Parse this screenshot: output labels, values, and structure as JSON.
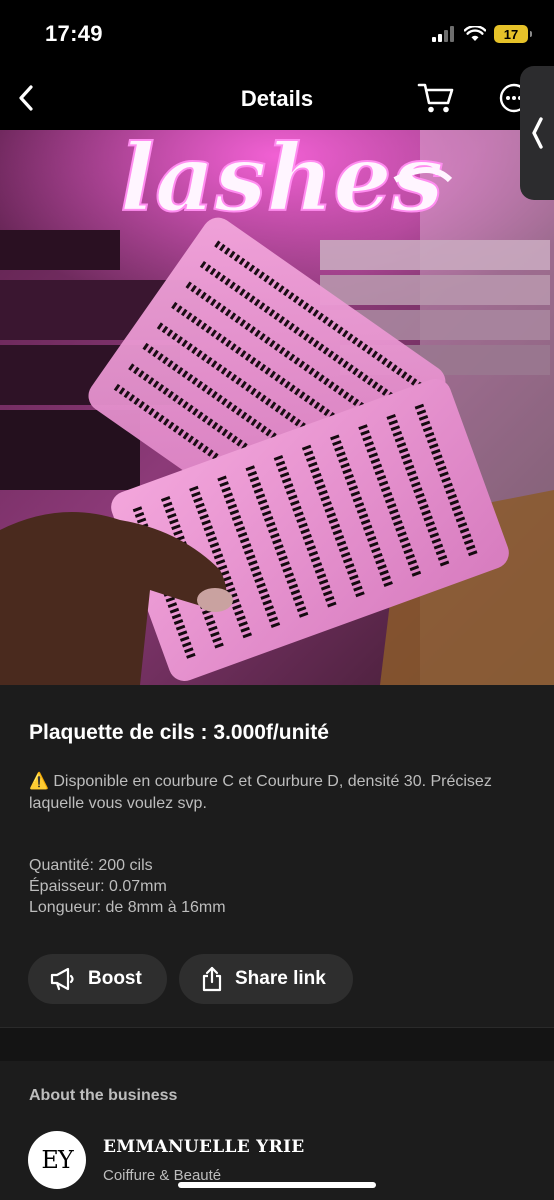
{
  "status_bar": {
    "time": "17:49",
    "battery": "17"
  },
  "nav": {
    "title": "Details"
  },
  "product": {
    "title": "Plaquette de cils : 3.000f/unité",
    "description_warning": "⚠️",
    "description": "Disponible en courbure C et Courbure D, densité 30. Précisez laquelle vous voulez svp.",
    "specs": [
      "Quantité: 200 cils",
      "Épaisseur: 0.07mm",
      "Longueur: de 8mm à 16mm"
    ],
    "image_sign_text": "lashes"
  },
  "actions": {
    "boost_label": "Boost",
    "share_label": "Share link"
  },
  "about": {
    "heading": "About the business",
    "name": "EMMANUELLE YRIE",
    "category": "Coiffure & Beauté",
    "logo_text": "EY"
  },
  "colors": {
    "accent_battery": "#e6c229",
    "neon_pink": "#ff4fd8",
    "background": "#1c1c1c"
  }
}
